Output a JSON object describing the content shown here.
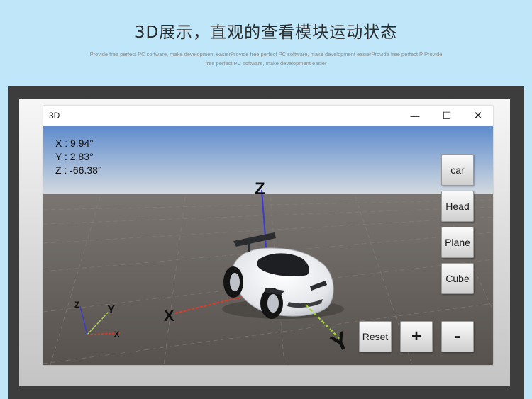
{
  "header": {
    "headline": "3D展示，直观的查看模块运动状态",
    "subtitle": "Provide free perfect PC software, make development easierProvide free perfect PC software, make development easierProvide free perfect P Provide free perfect PC software, make development easier"
  },
  "window": {
    "title": "3D",
    "minimize_glyph": "—",
    "maximize_glyph": "☐",
    "close_glyph": "✕"
  },
  "readouts": {
    "x": "X : 9.94°",
    "y": "Y : 2.83°",
    "z": "Z : -66.38°"
  },
  "side_buttons": [
    "car",
    "Head",
    "Plane",
    "Cube"
  ],
  "bottom_buttons": {
    "reset": "Reset",
    "plus": "+",
    "minus": "-"
  },
  "gizmo_labels": {
    "x": "X",
    "y": "Y",
    "z": "Z"
  },
  "colors": {
    "page_bg": "#bfe7f9",
    "sky_top": "#5f8ccc",
    "horizon": "#d9dce0",
    "ground": "#5e5955",
    "axis_x": "#e23a2a",
    "axis_y": "#a6d63a",
    "axis_z": "#3a3ad8"
  }
}
